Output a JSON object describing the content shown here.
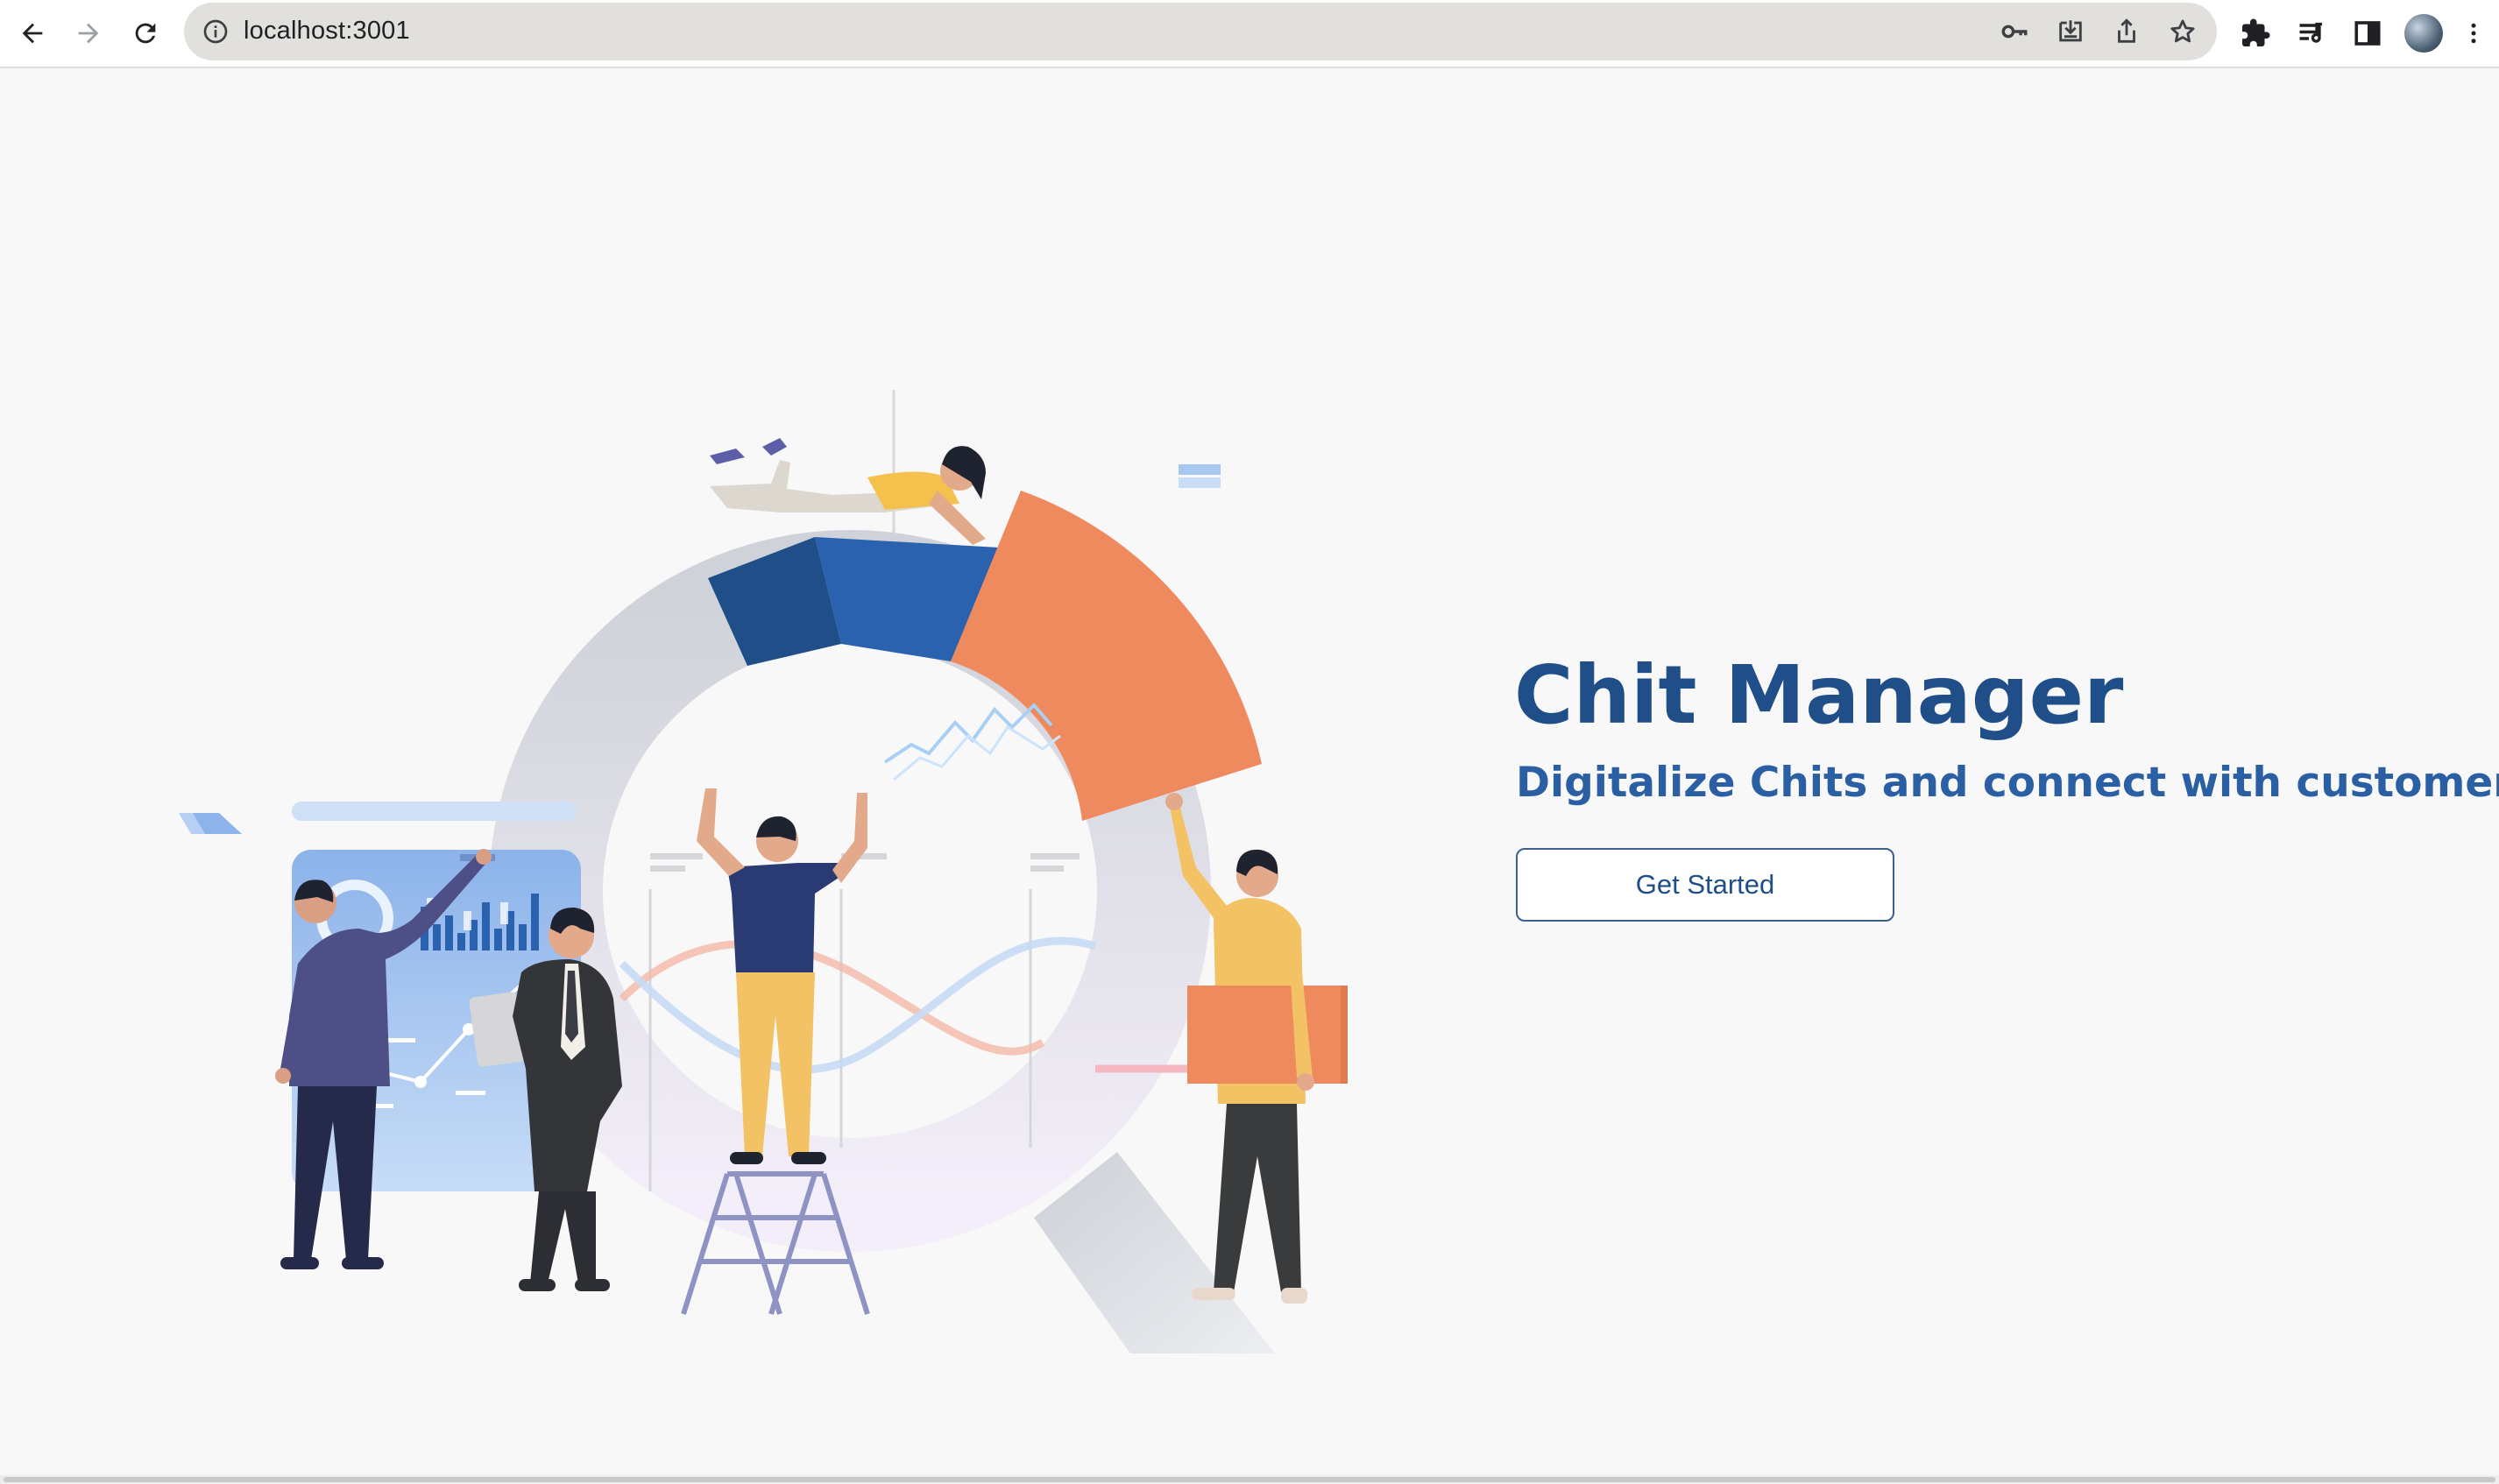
{
  "browser": {
    "url": "localhost:3001",
    "icons": {
      "back": "arrow-left-icon",
      "forward": "arrow-right-icon",
      "reload": "reload-icon",
      "site_info": "info-icon",
      "password": "key-icon",
      "install": "install-app-icon",
      "share": "share-icon",
      "bookmark": "star-icon",
      "extensions": "puzzle-icon",
      "reading_list": "reading-list-icon",
      "side_panel": "side-panel-icon",
      "profile": "avatar",
      "menu": "kebab-menu-icon"
    }
  },
  "hero": {
    "title": "Chit Manager",
    "subtitle": "Digitalize Chits and connect with customers.",
    "cta_label": "Get Started"
  },
  "colors": {
    "title": "#1f4e89",
    "subtitle": "#2a5fa3",
    "accent_orange": "#ef8a5f",
    "accent_blue": "#2a62b0",
    "background": "#f8f8f8"
  }
}
